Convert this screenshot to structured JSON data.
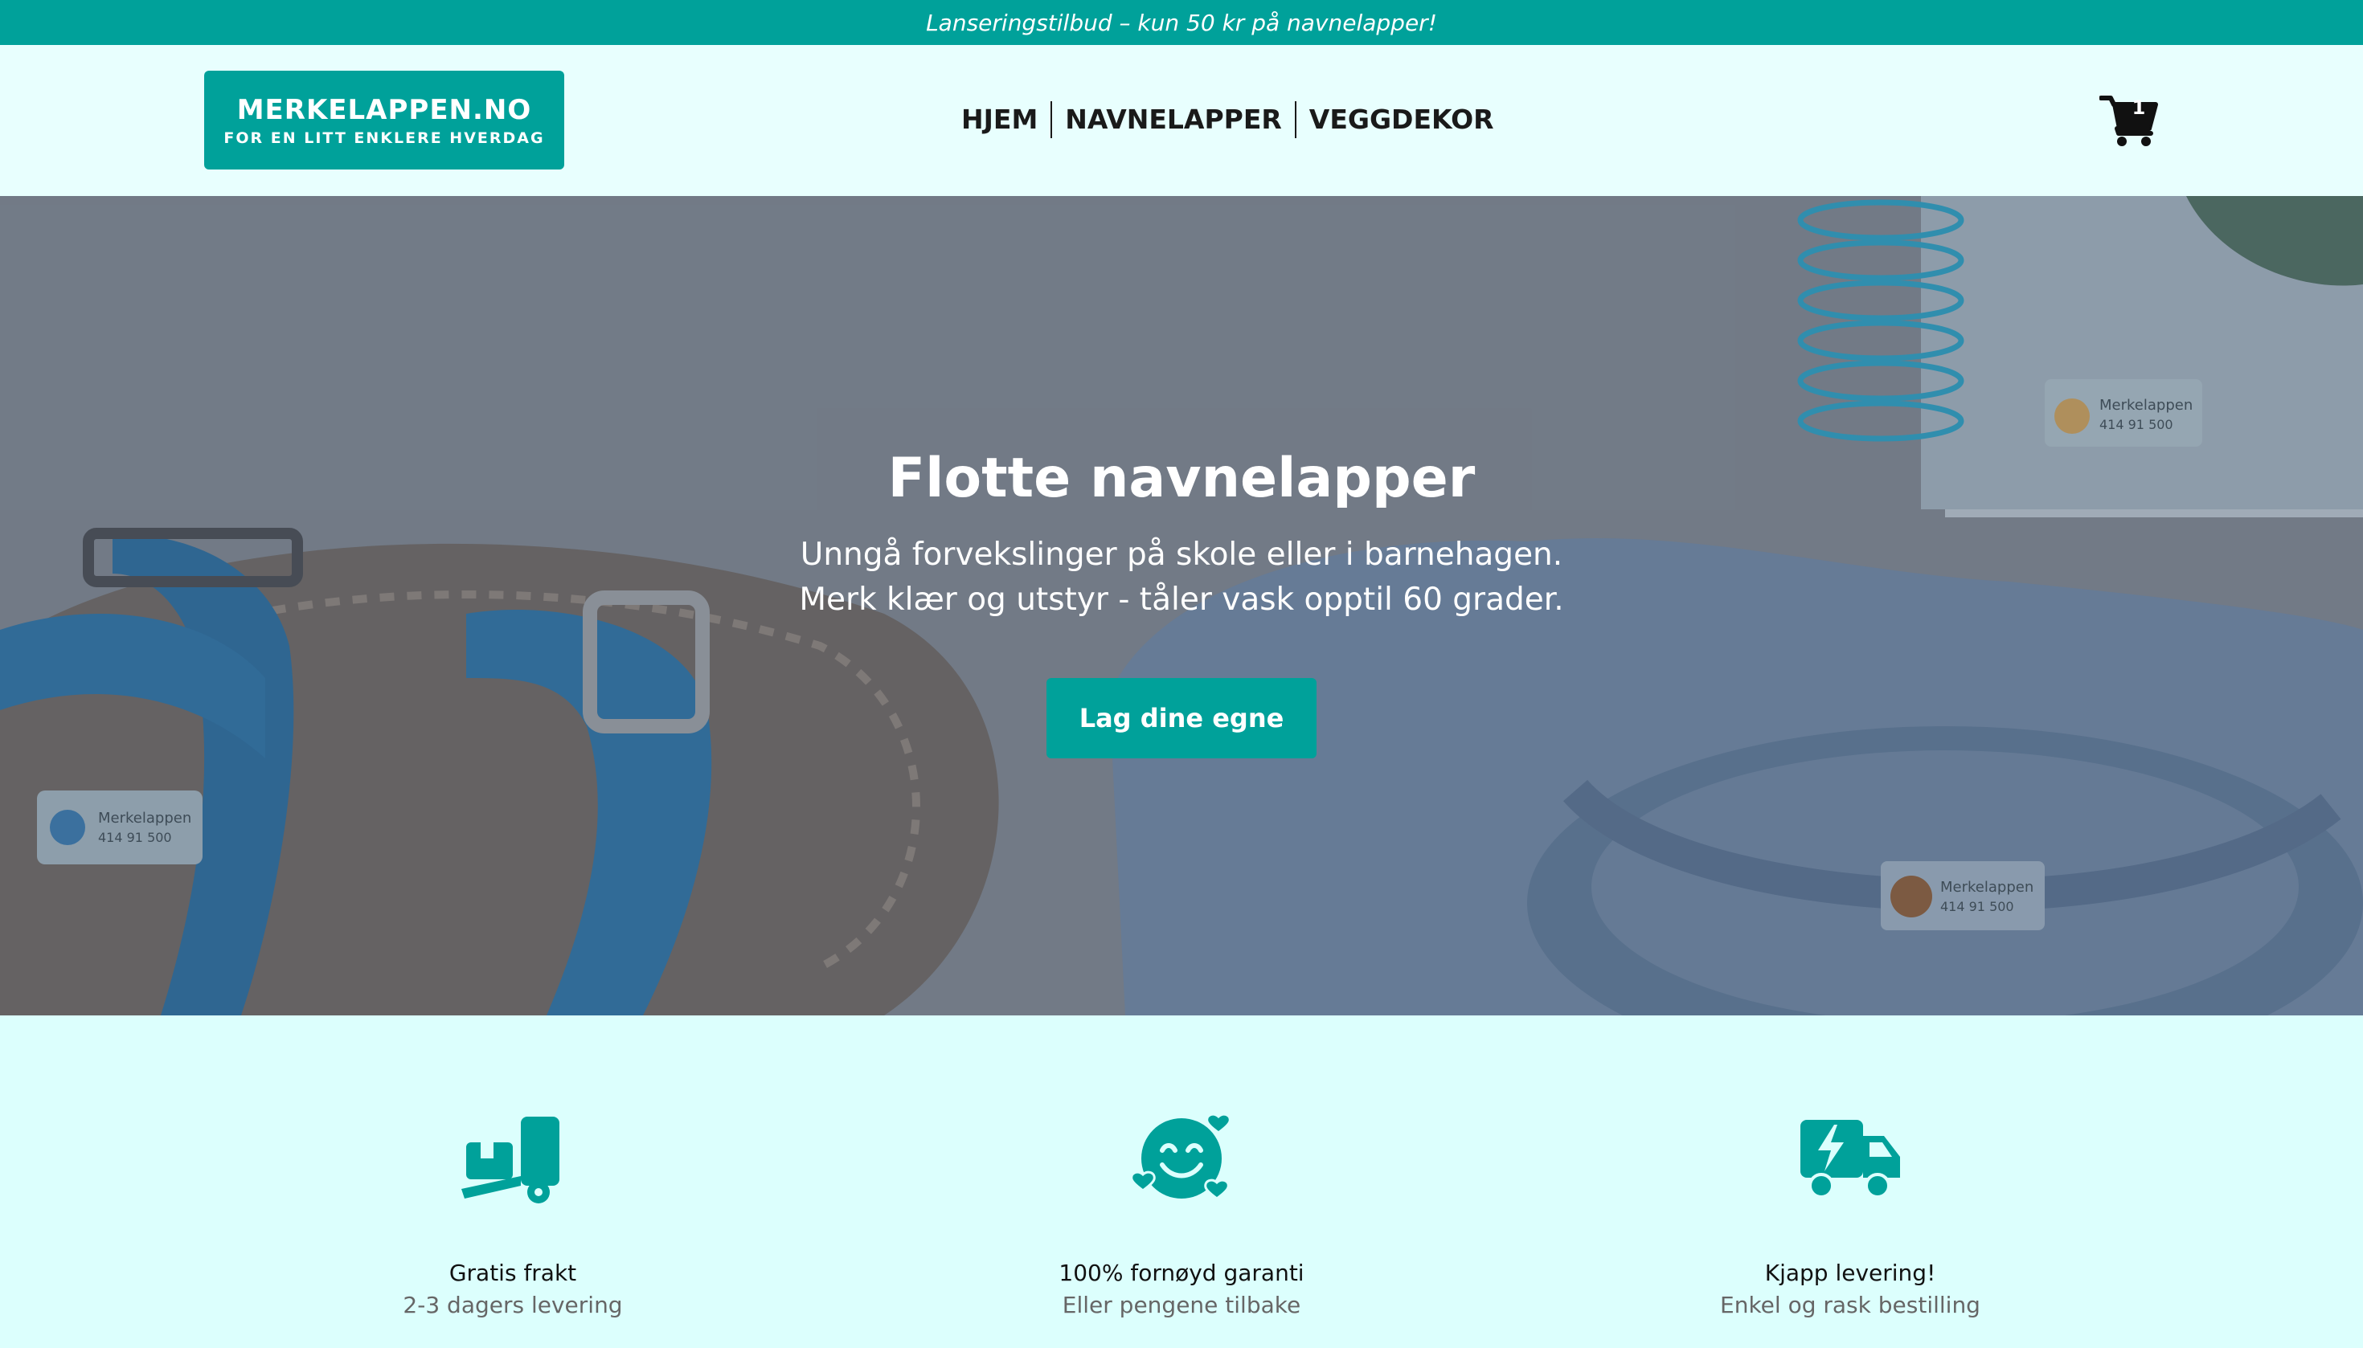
{
  "announcement": "Lanseringstilbud – kun 50 kr på navnelapper!",
  "logo": {
    "main": "MERKELAPPEN.NO",
    "tagline": "FOR EN LITT ENKLERE HVERDAG"
  },
  "nav": {
    "items": [
      {
        "label": "HJEM"
      },
      {
        "label": "NAVNELAPPER"
      },
      {
        "label": "VEGGDEKOR"
      }
    ]
  },
  "cart": {
    "icon": "shopping-cart-icon",
    "count": "1"
  },
  "hero": {
    "title": "Flotte navnelapper",
    "line1": "Unngå forvekslinger på skole eller i barnehagen.",
    "line2": "Merk klær og utstyr - tåler vask opptil 60 grader.",
    "cta": "Lag dine egne",
    "labels": [
      {
        "name": "Merkelappen",
        "phone": "414 91 500"
      },
      {
        "name": "Merkelappen",
        "phone": "414 91 500"
      },
      {
        "name": "Merkelappen",
        "phone": "414 91 500"
      }
    ]
  },
  "features": [
    {
      "icon": "package-truck-icon",
      "title": "Gratis frakt",
      "subtitle": "2-3 dagers levering"
    },
    {
      "icon": "smiley-hearts-icon",
      "title": "100% fornøyd garanti",
      "subtitle": "Eller pengene tilbake"
    },
    {
      "icon": "fast-truck-icon",
      "title": "Kjapp levering!",
      "subtitle": "Enkel og rask bestilling"
    }
  ],
  "colors": {
    "brand": "#00a19a",
    "header_bg": "#e8fffe",
    "features_bg": "#dcfffd"
  }
}
